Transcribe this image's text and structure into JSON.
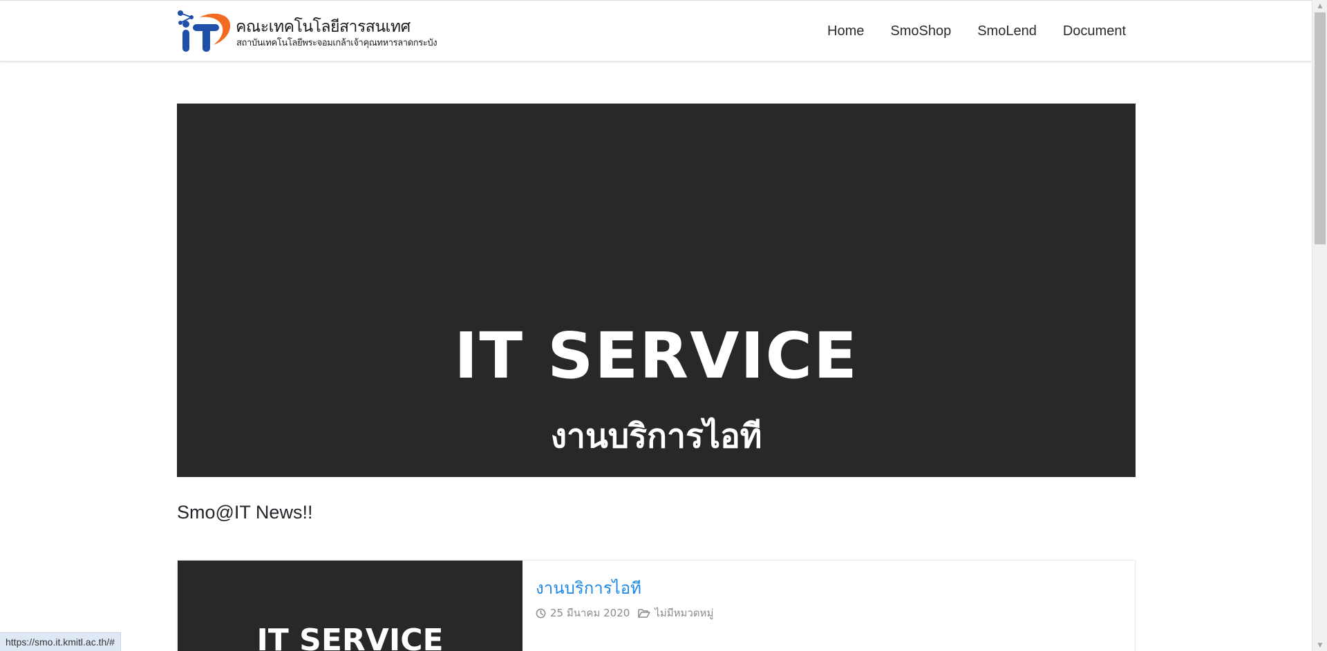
{
  "header": {
    "logo_mark": "iT",
    "logo_title": "คณะเทคโนโลยีสารสนเทศ",
    "logo_subtitle": "สถาบันเทคโนโลยีพระจอมเกล้าเจ้าคุณทหารลาดกระบัง",
    "nav": [
      {
        "label": "Home"
      },
      {
        "label": "SmoShop"
      },
      {
        "label": "SmoLend"
      },
      {
        "label": "Document"
      }
    ]
  },
  "hero": {
    "title": "IT SERVICE",
    "subtitle": "งานบริการไอที"
  },
  "news": {
    "heading": "Smo@IT News!!",
    "items": [
      {
        "thumb_text": "IT SERVICE",
        "title": "งานบริการไอที",
        "date": "25 มีนาคม 2020",
        "category": "ไม่มีหมวดหมู่"
      }
    ]
  },
  "status_bar": {
    "url": "https://smo.it.kmitl.ac.th/#"
  },
  "colors": {
    "banner_bg": "#282828",
    "link_blue": "#1e88e5",
    "logo_blue": "#1f4fa8",
    "logo_orange": "#f26b21"
  }
}
